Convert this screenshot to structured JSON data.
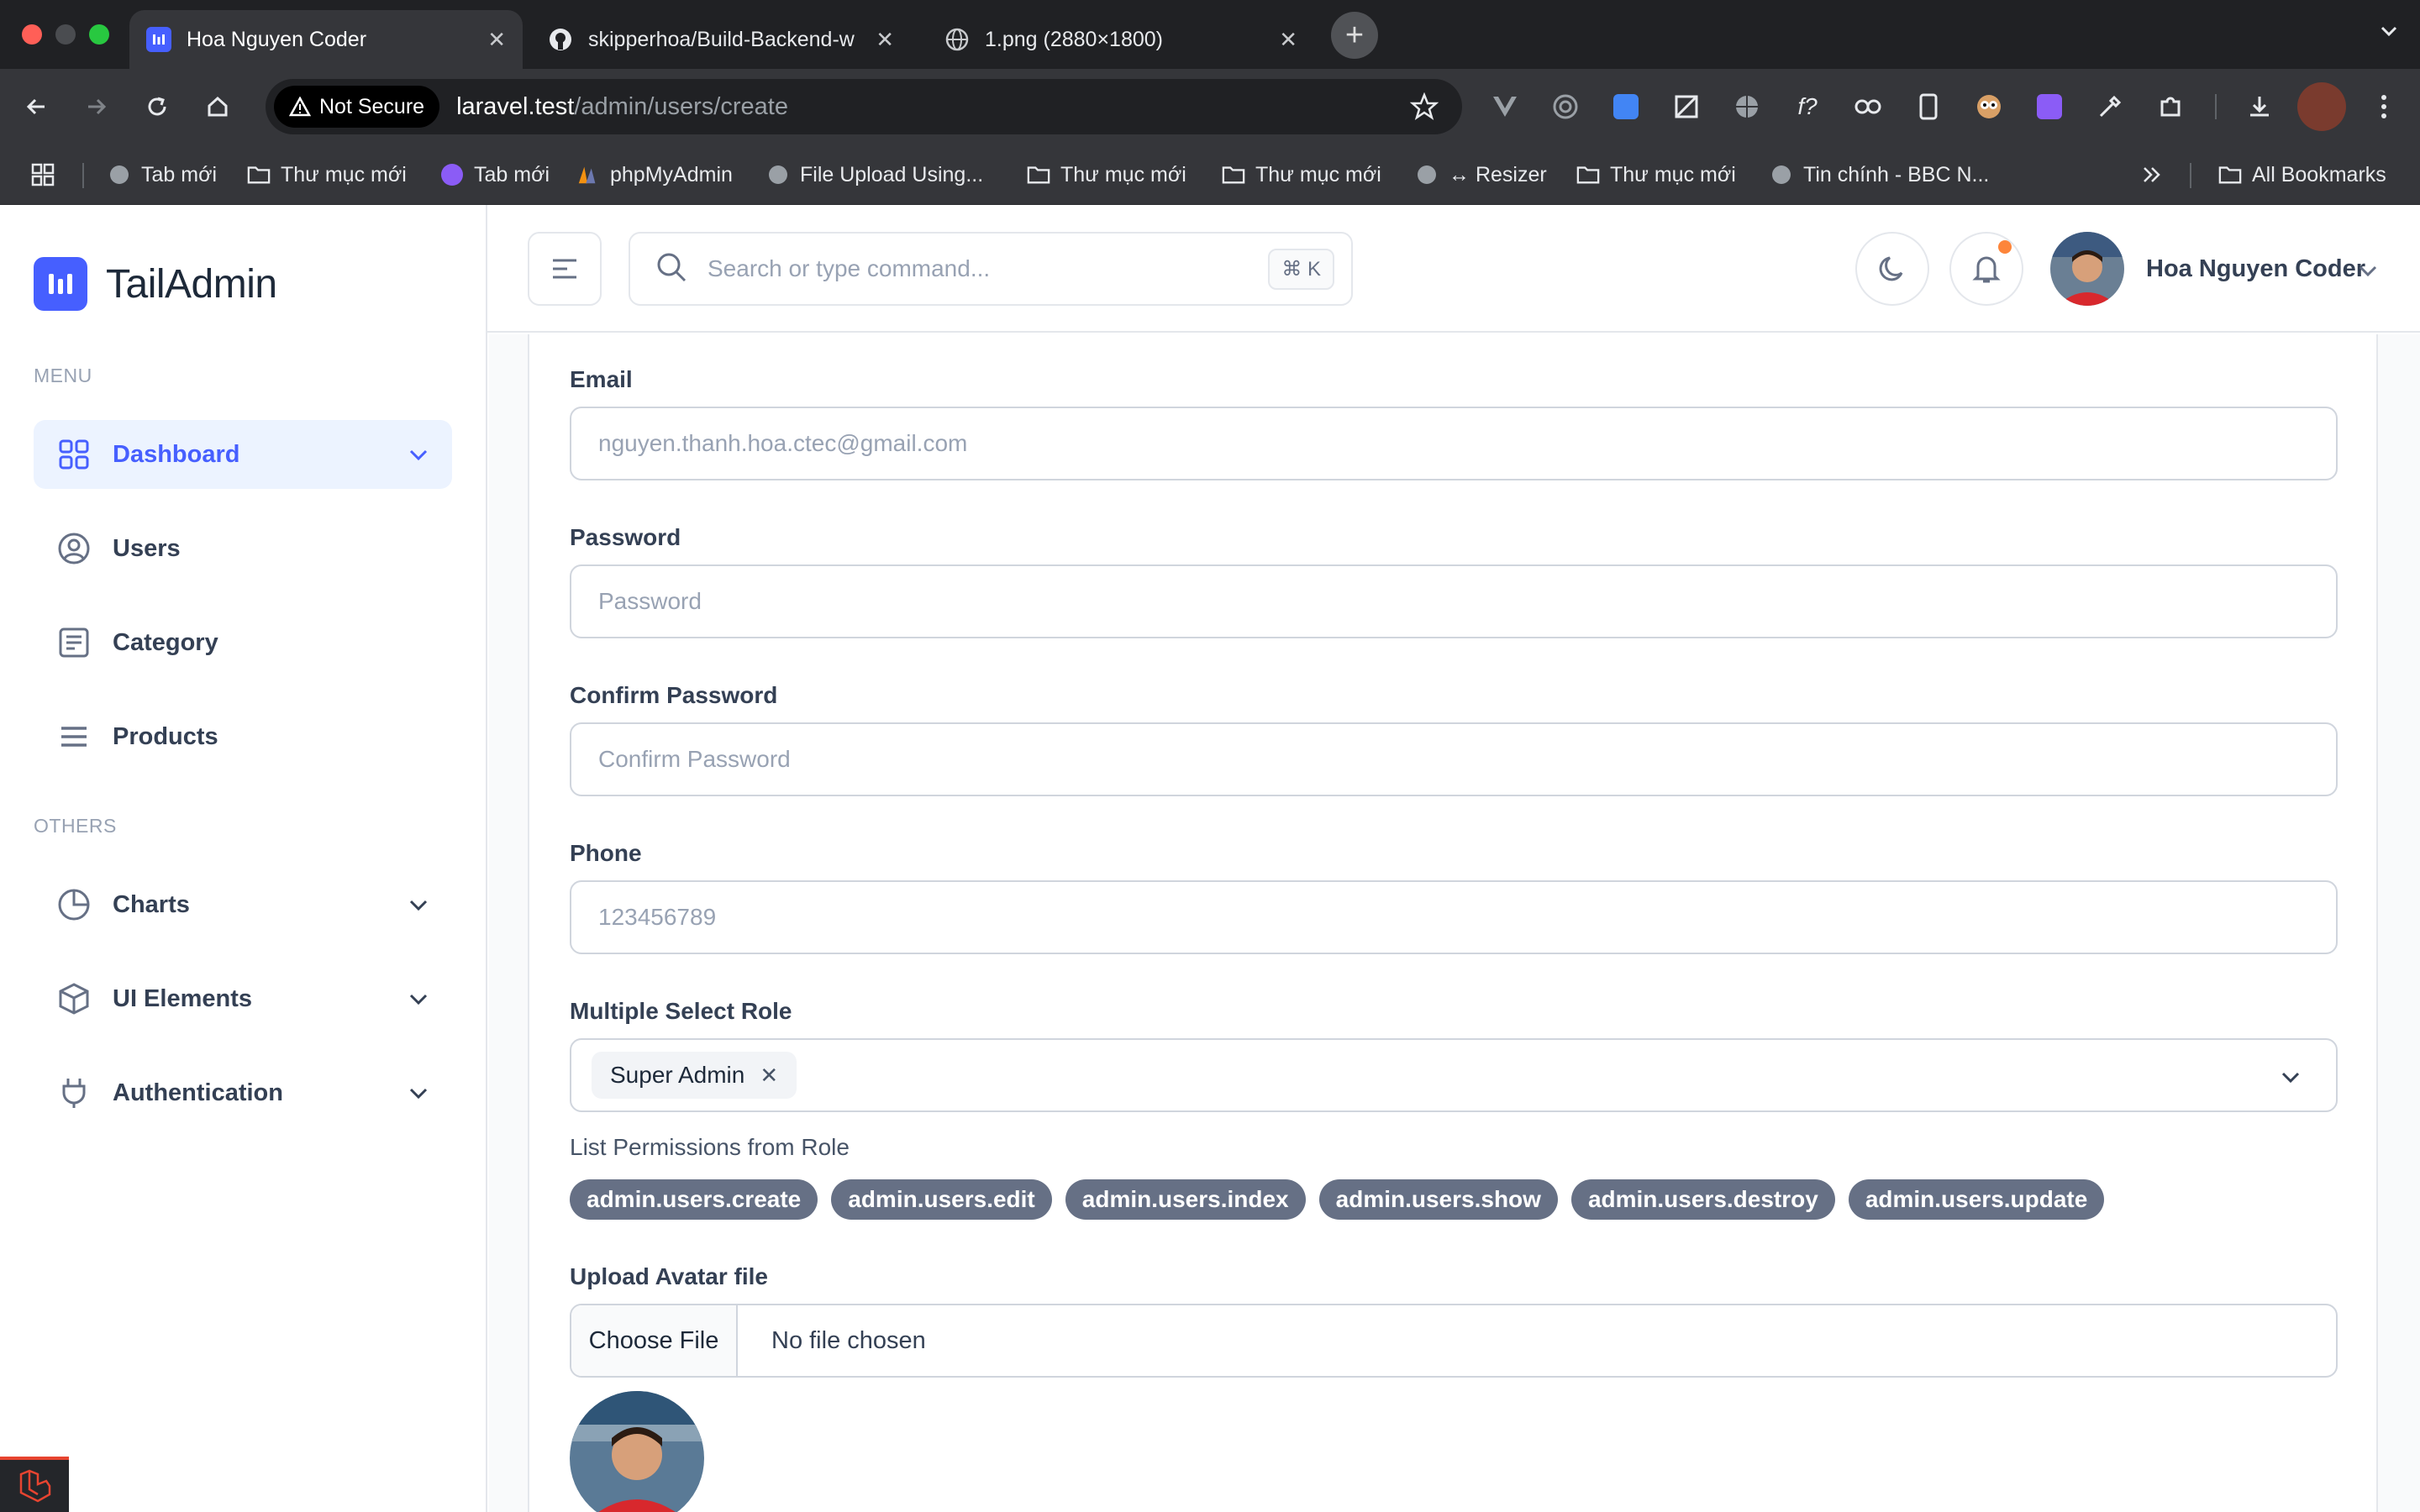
{
  "browser": {
    "tabs": [
      {
        "title": "Hoa Nguyen Coder",
        "active": true
      },
      {
        "title": "skipperhoa/Build-Backend-w",
        "active": false
      },
      {
        "title": "1.png (2880×1800)",
        "active": false
      }
    ],
    "security_label": "Not Secure",
    "url_host": "laravel.test",
    "url_path": "/admin/users/create",
    "bookmarks": [
      "Tab mới",
      "Thư mục mới",
      "Tab mới",
      "phpMyAdmin",
      "File Upload Using...",
      "Thư mục mới",
      "Thư mục mới",
      "↔ Resizer",
      "Thư mục mới",
      "Tin chính - BBC N...",
      "All Bookmarks"
    ]
  },
  "sidebar": {
    "brand": "TailAdmin",
    "menu_heading": "MENU",
    "menu": [
      {
        "label": "Dashboard",
        "icon": "grid-icon",
        "active": true,
        "has_submenu": true
      },
      {
        "label": "Users",
        "icon": "user-circle-icon",
        "active": false,
        "has_submenu": false
      },
      {
        "label": "Category",
        "icon": "list-box-icon",
        "active": false,
        "has_submenu": false
      },
      {
        "label": "Products",
        "icon": "menu-lines-icon",
        "active": false,
        "has_submenu": false
      }
    ],
    "others_heading": "OTHERS",
    "others": [
      {
        "label": "Charts",
        "icon": "pie-chart-icon",
        "has_submenu": true
      },
      {
        "label": "UI Elements",
        "icon": "box-icon",
        "has_submenu": true
      },
      {
        "label": "Authentication",
        "icon": "plug-icon",
        "has_submenu": true
      }
    ]
  },
  "header": {
    "search_placeholder": "Search or type command...",
    "shortcut": "⌘ K",
    "user_name": "Hoa Nguyen Coder"
  },
  "form": {
    "email_label": "Email",
    "email_value": "nguyen.thanh.hoa.ctec@gmail.com",
    "password_label": "Password",
    "password_placeholder": "Password",
    "confirm_label": "Confirm Password",
    "confirm_placeholder": "Confirm Password",
    "phone_label": "Phone",
    "phone_value": "123456789",
    "role_label": "Multiple Select Role",
    "selected_roles": [
      "Super Admin"
    ],
    "permissions_label": "List Permissions from Role",
    "permissions": [
      "admin.users.create",
      "admin.users.edit",
      "admin.users.index",
      "admin.users.show",
      "admin.users.destroy",
      "admin.users.update"
    ],
    "avatar_label": "Upload Avatar file",
    "choose_file": "Choose File",
    "file_status": "No file chosen"
  },
  "colors": {
    "brand": "#465fff",
    "active_bg": "#ecf3ff",
    "badge_bg": "#667085",
    "notify_dot": "#fd853a"
  }
}
